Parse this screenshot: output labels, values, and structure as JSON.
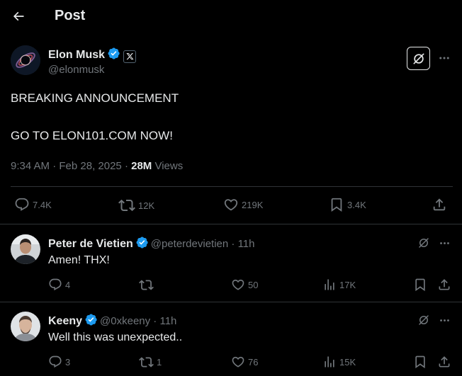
{
  "header": {
    "title": "Post"
  },
  "post": {
    "author": {
      "name": "Elon Musk",
      "handle": "@elonmusk"
    },
    "text_line1": "BREAKING ANNOUNCEMENT",
    "text_line2": "GO TO ELON101.COM NOW!",
    "timestamp": "9:34 AM · Feb 28, 2025",
    "meta_sep": " · ",
    "views_count": "28M",
    "views_label": " Views",
    "stats": {
      "replies": "7.4K",
      "reposts": "12K",
      "likes": "219K",
      "bookmarks": "3.4K"
    }
  },
  "replies": [
    {
      "name": "Peter de Vietien",
      "handle": "@peterdevietien",
      "time": " · 11h",
      "text": "Amen! THX!",
      "stats": {
        "replies": "4",
        "reposts": "",
        "likes": "50",
        "views": "17K"
      }
    },
    {
      "name": "Keeny",
      "handle": "@0xkeeny",
      "time": " · 11h",
      "text": "Well this was unexpected..",
      "stats": {
        "replies": "3",
        "reposts": "1",
        "likes": "76",
        "views": "15K"
      }
    }
  ],
  "colors": {
    "background": "#000000",
    "text": "#e7e9ea",
    "muted": "#71767b",
    "verified": "#1d9bf0",
    "divider": "#2f3336"
  }
}
